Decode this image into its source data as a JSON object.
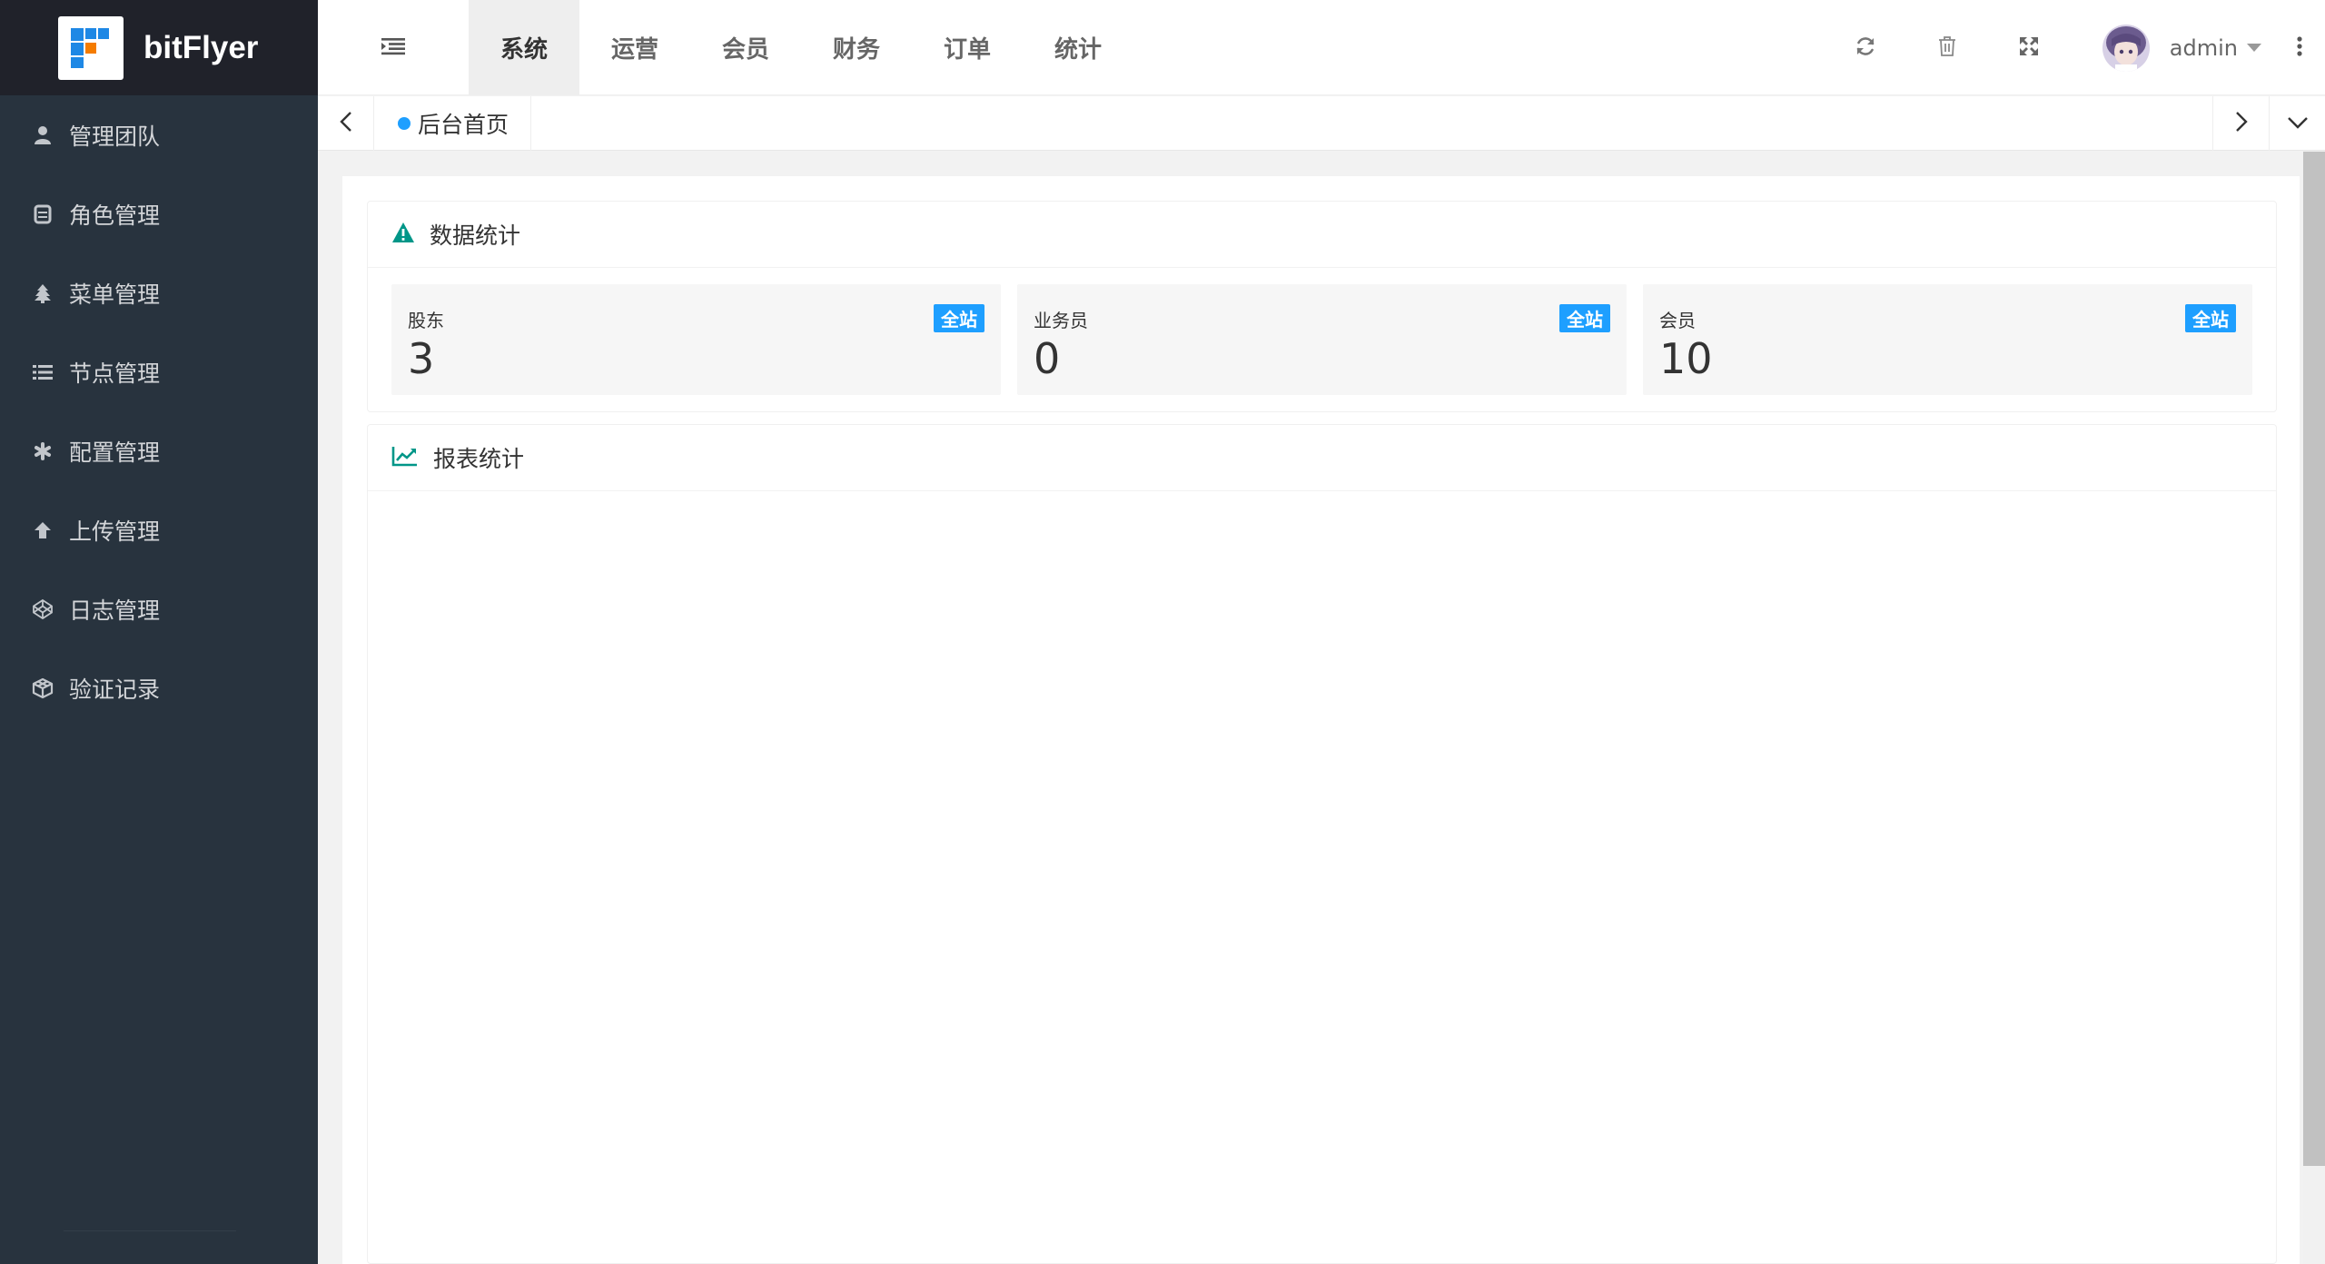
{
  "app": {
    "title": "bitFlyer"
  },
  "sidebar": {
    "items": [
      {
        "label": "管理团队",
        "icon": "user-icon"
      },
      {
        "label": "角色管理",
        "icon": "database-icon"
      },
      {
        "label": "菜单管理",
        "icon": "tree-icon"
      },
      {
        "label": "节点管理",
        "icon": "list-icon"
      },
      {
        "label": "配置管理",
        "icon": "asterisk-icon"
      },
      {
        "label": "上传管理",
        "icon": "arrow-up-icon"
      },
      {
        "label": "日志管理",
        "icon": "codepen-icon"
      },
      {
        "label": "验证记录",
        "icon": "cube-icon"
      }
    ]
  },
  "header": {
    "tabs": [
      {
        "label": "系统",
        "active": true
      },
      {
        "label": "运营",
        "active": false
      },
      {
        "label": "会员",
        "active": false
      },
      {
        "label": "财务",
        "active": false
      },
      {
        "label": "订单",
        "active": false
      },
      {
        "label": "统计",
        "active": false
      }
    ],
    "username": "admin"
  },
  "tabbar": {
    "current_tab": "后台首页"
  },
  "data_stats": {
    "title": "数据统计",
    "cards": [
      {
        "label": "股东",
        "value": "3",
        "badge": "全站"
      },
      {
        "label": "业务员",
        "value": "0",
        "badge": "全站"
      },
      {
        "label": "会员",
        "value": "10",
        "badge": "全站"
      }
    ]
  },
  "report_stats": {
    "title": "报表统计"
  },
  "colors": {
    "sidebar_bg": "#28333e",
    "logo_bg": "#20222a",
    "accent": "#1e9fff",
    "icon_teal": "#009688"
  }
}
